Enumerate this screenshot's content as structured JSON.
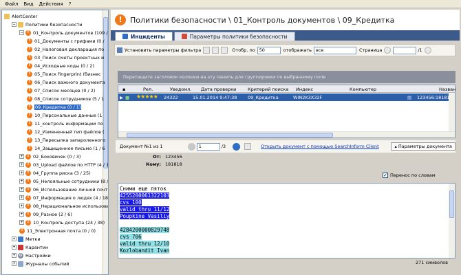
{
  "menu": [
    "Файл",
    "Вид",
    "Действия",
    "?"
  ],
  "tree": {
    "items": [
      {
        "label": "AlertCenter",
        "icon": "folder",
        "exp": "",
        "indent": 0
      },
      {
        "label": "Политики безопасности",
        "icon": "folder",
        "exp": "−",
        "indent": 1
      },
      {
        "label": "01_Контроль документов (109 /",
        "icon": "alert",
        "exp": "−",
        "indent": 2
      },
      {
        "label": "01_Документы с грифами (0 /",
        "icon": "alert",
        "exp": "",
        "indent": 3
      },
      {
        "label": "02_Налоговая декларация по",
        "icon": "alert",
        "exp": "",
        "indent": 3
      },
      {
        "label": "03_Поиск сметы проектных и",
        "icon": "alert",
        "exp": "",
        "indent": 3
      },
      {
        "label": "04_Исходные коды (0 / 2)",
        "icon": "alert",
        "exp": "",
        "indent": 3
      },
      {
        "label": "05_Поиск fingerprint (бизнес",
        "icon": "alert",
        "exp": "",
        "indent": 3
      },
      {
        "label": "06_Поиск важного документа",
        "icon": "alert",
        "exp": "",
        "indent": 3
      },
      {
        "label": "07_Список месяцев (0 / 2)",
        "icon": "alert",
        "exp": "",
        "indent": 3
      },
      {
        "label": "08_Список сотрудников (5 / 1",
        "icon": "alert",
        "exp": "",
        "indent": 3
      },
      {
        "label": "09_Кредитка (0 / 1)",
        "icon": "alert",
        "exp": "",
        "indent": 3,
        "selected": true
      },
      {
        "label": "10_Персональные данные (1",
        "icon": "alert",
        "exp": "",
        "indent": 3
      },
      {
        "label": "11_контроль информации по",
        "icon": "alert",
        "exp": "",
        "indent": 3
      },
      {
        "label": "12_Измененный тип файлов (",
        "icon": "alert",
        "exp": "",
        "indent": 3
      },
      {
        "label": "13_Пересылка запароленного",
        "icon": "alert",
        "exp": "",
        "indent": 3
      },
      {
        "label": "14_Защищенное письмо (1 / 6",
        "icon": "alert",
        "exp": "",
        "indent": 3
      },
      {
        "label": "02_Боковичек (0 / 3)",
        "icon": "alert",
        "exp": "+",
        "indent": 2
      },
      {
        "label": "03_Upload файлов по HTTP (4 / 15",
        "icon": "alert",
        "exp": "+",
        "indent": 2
      },
      {
        "label": "04_Группа риска (3 / 25)",
        "icon": "alert",
        "exp": "+",
        "indent": 2
      },
      {
        "label": "05_Нелояльные сотрудники (8 /",
        "icon": "alert",
        "exp": "+",
        "indent": 2
      },
      {
        "label": "06_Использование личной почты",
        "icon": "alert",
        "exp": "+",
        "indent": 2
      },
      {
        "label": "07_Информация о людях (4 / 18)",
        "icon": "alert",
        "exp": "+",
        "indent": 2
      },
      {
        "label": "08_Нерациональное использован",
        "icon": "alert",
        "exp": "+",
        "indent": 2
      },
      {
        "label": "09_Разное (2 / 6)",
        "icon": "alert",
        "exp": "+",
        "indent": 2
      },
      {
        "label": "10_Контроль доступа (24 / 38)",
        "icon": "alert",
        "exp": "+",
        "indent": 2
      },
      {
        "label": "11_Электронная почта (0 / 0)",
        "icon": "alert",
        "exp": "",
        "indent": 2
      },
      {
        "label": "Метки",
        "icon": "mark",
        "exp": "+",
        "indent": 1
      },
      {
        "label": "Карантин",
        "icon": "kar",
        "exp": "+",
        "indent": 1
      },
      {
        "label": "Настройки",
        "icon": "gear",
        "exp": "+",
        "indent": 1
      },
      {
        "label": "Журналы событий",
        "icon": "log",
        "exp": "+",
        "indent": 1
      }
    ]
  },
  "header": {
    "title": "Политики безопасности \\ 01_Контроль документов \\ 09_Кредитка"
  },
  "tabs": [
    {
      "label": "Инциденты",
      "active": true
    },
    {
      "label": "Параметры политики безопасности",
      "active": false
    }
  ],
  "toolbar": {
    "filter_label": "Установить параметры фильтра",
    "show_by_label": "Отобр. по",
    "show_by_value": "50",
    "display_label": "отображать",
    "display_value": "все",
    "page_label": "Страница",
    "page_value": "",
    "page_total": "/1"
  },
  "group_panel": {
    "text": "Перетащите заголовок колонки на эту панель для группировки по выбранному поле"
  },
  "grid": {
    "columns": [
      "Рел.",
      "Уведомл.",
      "Дата проверки",
      "Критерий поиска",
      "Индекс",
      "Компьютер",
      "Назван"
    ],
    "row": {
      "rating": "★★★★★",
      "notify": "24322",
      "date": "15.01.2014 9:47:38",
      "criterion": "09_Кредитка",
      "index": "WIN2K3X32F",
      "computer": "",
      "name": "123456:181818"
    }
  },
  "doc": {
    "label": "Документ №1 из 1",
    "page_value": "1",
    "page_total": "/3",
    "link": "Открыть документ с помощью SearchInform Client",
    "params_label": "Параметры документа",
    "from_label": "От:",
    "from_value": "123456",
    "to_label": "Кому:",
    "to_value": "181818",
    "wrap_label": "Перенос по словам",
    "lines": [
      {
        "text": "Сними еще пяток",
        "hl": ""
      },
      {
        "text": "4255200061322103",
        "hl": "hl1"
      },
      {
        "text": "cvs 100",
        "hl": "hl1"
      },
      {
        "text": "valid thru 11/12",
        "hl": "hl1"
      },
      {
        "text": "Poupkine Vasiliy",
        "hl": "hl1"
      },
      {
        "text": "",
        "hl": ""
      },
      {
        "text": "4284200000829748",
        "hl": "hl2"
      },
      {
        "text": "cvs 706",
        "hl": "hl2"
      },
      {
        "text": "valid thru 12/10",
        "hl": "hl2"
      },
      {
        "text": "Kozlobandit Ivan",
        "hl": "hl2"
      }
    ],
    "char_count": "271 символов"
  }
}
